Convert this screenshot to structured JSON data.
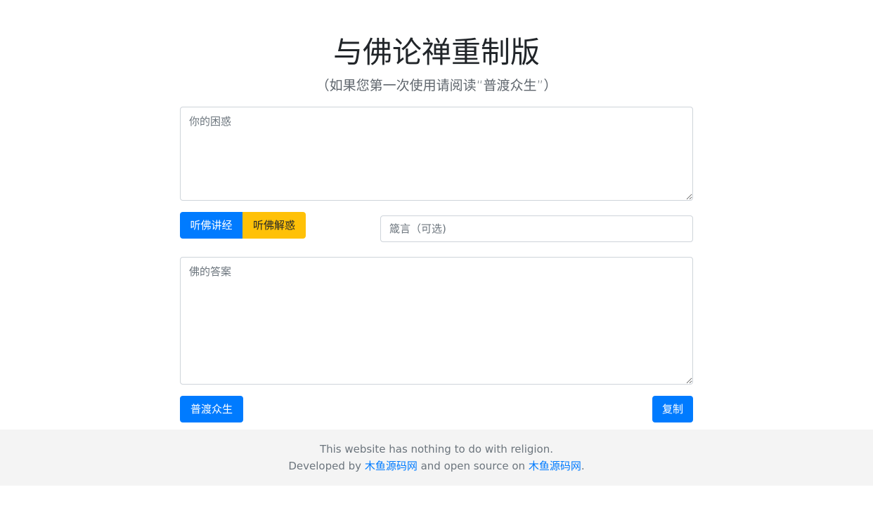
{
  "page": {
    "title": "与佛论禅重制版",
    "subtitle": "（如果您第一次使用请阅读“普渡众生”）"
  },
  "form": {
    "confusion_placeholder": "你的困惑",
    "listen_sutra_label": "听佛讲经",
    "listen_resolve_label": "听佛解惑",
    "motto_placeholder": "箴言（可选)",
    "answer_placeholder": "佛的答案",
    "save_all_label": "普渡众生",
    "copy_label": "复制"
  },
  "footer": {
    "line1": "This website has nothing to do with religion.",
    "developed_by": "Developed by ",
    "developer_link": "木鱼源码网",
    "open_source_text": " and open source on ",
    "source_link": "木鱼源码网",
    "period": "."
  },
  "colors": {
    "primary": "#007bff",
    "warning": "#ffc107",
    "footer_bg": "#f4f4f4"
  }
}
